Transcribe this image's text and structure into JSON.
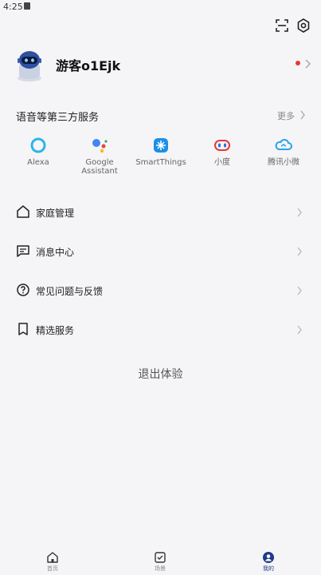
{
  "status_bar": {
    "time": "4:25"
  },
  "profile": {
    "username": "游客o1Ejk"
  },
  "services": {
    "title": "语音等第三方服务",
    "more_label": "更多",
    "items": [
      {
        "label": "Alexa",
        "icon": "alexa-icon",
        "color": "#2bb5e8"
      },
      {
        "label": "Google\nAssistant",
        "icon": "google-assistant-icon",
        "color": "#4285f4"
      },
      {
        "label": "SmartThings",
        "icon": "smartthings-icon",
        "color": "#1a8fe8"
      },
      {
        "label": "小度",
        "icon": "xiaodu-icon",
        "color": "#e53935"
      },
      {
        "label": "腾讯小微",
        "icon": "tencent-xiaowei-icon",
        "color": "#29a3e8"
      }
    ]
  },
  "menu": {
    "items": [
      {
        "label": "家庭管理",
        "icon": "home-icon"
      },
      {
        "label": "消息中心",
        "icon": "message-icon"
      },
      {
        "label": "常见问题与反馈",
        "icon": "help-icon"
      },
      {
        "label": "精选服务",
        "icon": "bookmark-icon"
      }
    ]
  },
  "logout_label": "退出体验",
  "bottom_nav": {
    "tabs": [
      {
        "label": "首页",
        "active": false
      },
      {
        "label": "场景",
        "active": false
      },
      {
        "label": "我的",
        "active": true
      }
    ]
  },
  "colors": {
    "accent": "#1d3a8a",
    "background": "#f5f5f7",
    "notification_dot": "#e53935"
  }
}
